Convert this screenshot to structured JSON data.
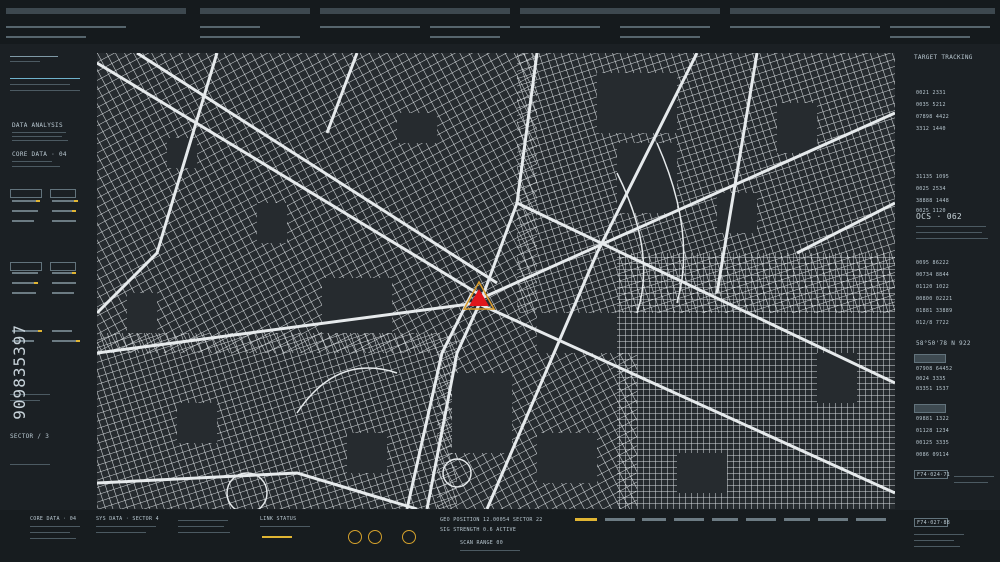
{
  "left_panel": {
    "section_data_analysis": "DATA ANALYSIS",
    "section_core_data": "CORE DATA · 04",
    "sector_label": "SECTOR / 3",
    "stock_id": "909835397"
  },
  "right_panel": {
    "target_tracking": "TARGET TRACKING",
    "code": "OCS · 062",
    "numbers_top": [
      "0021 2331",
      "0035 5212",
      "07898 4422",
      "3312 1440",
      "31135 1095"
    ],
    "numbers_mid": [
      "0025 2534",
      "38888 1448",
      "0025 1120"
    ],
    "numbers_low": [
      "0095 86222",
      "00734 8844",
      "01120 1022",
      "00800 02221",
      "01881 33889",
      "012/8 7722"
    ],
    "coord": "58°50'78 N 922",
    "numbers_bottom": [
      "07908 64452",
      "0024 3335",
      "03351 1537",
      "09881 1322",
      "01128 1234",
      "00125 3335",
      "0086 09114"
    ],
    "bottom_tag_1": "F74·024·71",
    "bottom_tag_2": "F74·027·88"
  },
  "bottom_panel": {
    "status_1": "CORE DATA · 04",
    "status_2": "SYS DATA · SECTOR 4",
    "status_3": "LINK STATUS",
    "readout_1": "GEO POSITION 12.00054 SECTOR 22",
    "readout_2": "SIG STRENGTH 0.6 ACTIVE",
    "readout_3": "SCAN RANGE 00"
  },
  "colors": {
    "accent": "#e0b533",
    "marker": "#e0161c",
    "map_road": "#d8dde0"
  }
}
